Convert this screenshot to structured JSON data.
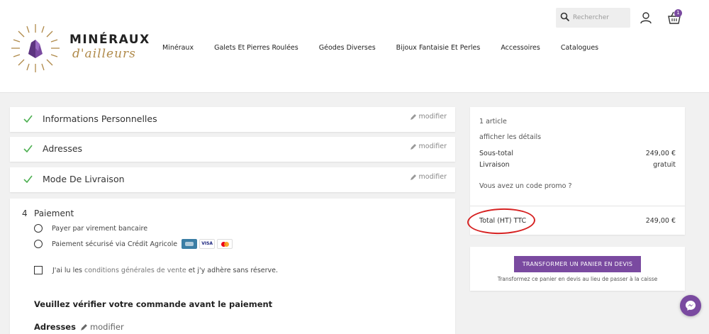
{
  "header": {
    "logo": {
      "title": "MINÉRAUX",
      "subtitle": "d'ailleurs"
    },
    "nav": [
      "Minéraux",
      "Galets Et Pierres Roulées",
      "Géodes Diverses",
      "Bijoux Fantaisie Et Perles",
      "Accessoires",
      "Catalogues"
    ],
    "search_placeholder": "Rechercher",
    "cart_count": "1"
  },
  "steps": [
    {
      "title": "Informations Personnelles",
      "edit": "modifier"
    },
    {
      "title": "Adresses",
      "edit": "modifier"
    },
    {
      "title": "Mode De Livraison",
      "edit": "modifier"
    }
  ],
  "payment": {
    "number": "4",
    "title": "Paiement",
    "option1": "Payer par virement bancaire",
    "option2": "Paiement sécurisé via Crédit Agricole",
    "cards": {
      "visa": "VISA"
    },
    "terms_prefix": "J'ai lu les",
    "terms_link": "conditions générales de vente",
    "terms_suffix": "et j'y adhère sans réserve.",
    "verify": "Veuillez vérifier votre commande avant le paiement",
    "addresses_label": "Adresses",
    "addresses_edit": "modifier"
  },
  "summary": {
    "article_count": "1 article",
    "details": "afficher les détails",
    "subtotal_label": "Sous-total",
    "subtotal_value": "249,00 €",
    "shipping_label": "Livraison",
    "shipping_value": "gratuit",
    "promo": "Vous avez un code promo ?",
    "total_label": "Total (HT) TTC",
    "total_value": "249,00 €"
  },
  "devis": {
    "button": "TRANSFORMER UN PANIER EN DEVIS",
    "note": "Transformez ce panier en devis au lieu de passer à la caisse"
  },
  "colors": {
    "accent": "#7a4aa0",
    "check": "#4caf50",
    "annotation": "#d62222"
  }
}
